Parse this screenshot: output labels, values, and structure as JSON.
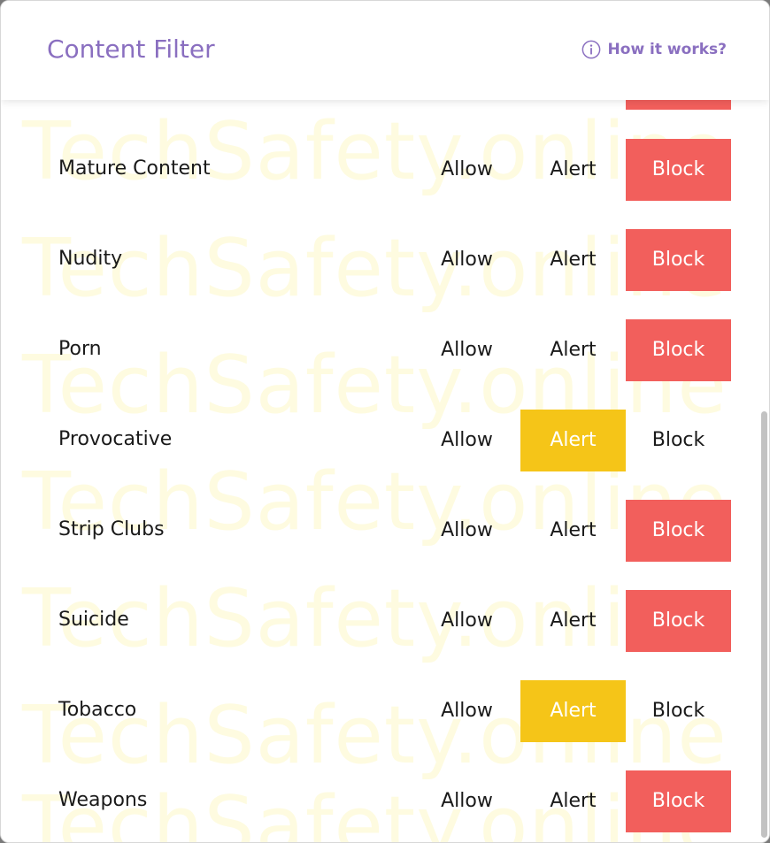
{
  "header": {
    "title": "Content Filter",
    "help_label": "How it works?",
    "help_icon": "info-icon"
  },
  "watermark": "TechSafety.online",
  "options": [
    "Allow",
    "Alert",
    "Block"
  ],
  "categories": [
    {
      "label": "Mature Content",
      "selected": "Block"
    },
    {
      "label": "Nudity",
      "selected": "Block"
    },
    {
      "label": "Porn",
      "selected": "Block"
    },
    {
      "label": "Provocative",
      "selected": "Alert"
    },
    {
      "label": "Strip Clubs",
      "selected": "Block"
    },
    {
      "label": "Suicide",
      "selected": "Block"
    },
    {
      "label": "Tobacco",
      "selected": "Alert"
    },
    {
      "label": "Weapons",
      "selected": "Block"
    }
  ],
  "colors": {
    "accent": "#8a6fc0",
    "block": "#f25f5c",
    "alert": "#f5c518"
  }
}
